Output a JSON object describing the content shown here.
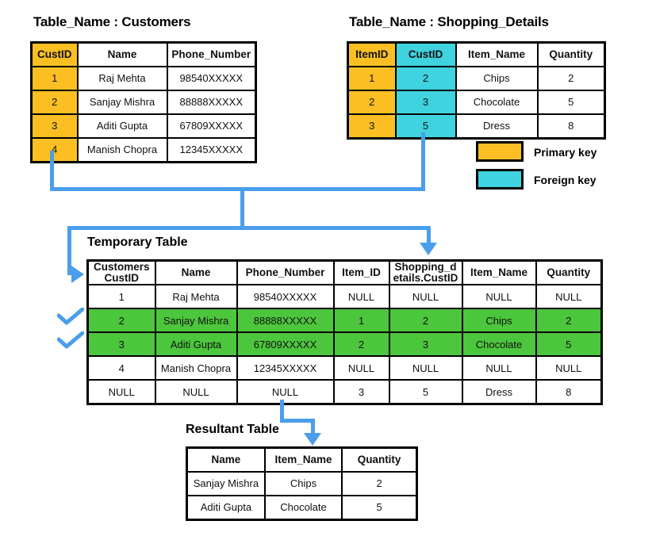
{
  "diagram": {
    "title_prefix": "Table_Name :",
    "customers": {
      "title": "Table_Name : Customers",
      "columns": [
        "CustID",
        "Name",
        "Phone_Number"
      ],
      "rows": [
        [
          "1",
          "Raj Mehta",
          "98540XXXXX"
        ],
        [
          "2",
          "Sanjay Mishra",
          "88888XXXXX"
        ],
        [
          "3",
          "Aditi Gupta",
          "67809XXXXX"
        ],
        [
          "4",
          "Manish Chopra",
          "12345XXXXX"
        ]
      ]
    },
    "shopping_details": {
      "title": "Table_Name : Shopping_Details",
      "columns": [
        "ItemID",
        "CustID",
        "Item_Name",
        "Quantity"
      ],
      "rows": [
        [
          "1",
          "2",
          "Chips",
          "2"
        ],
        [
          "2",
          "3",
          "Chocolate",
          "5"
        ],
        [
          "3",
          "5",
          "Dress",
          "8"
        ]
      ]
    },
    "legend": {
      "primary_key_label": "Primary key",
      "foreign_key_label": "Foreign key",
      "primary_key_color": "#FBBF24",
      "foreign_key_color": "#3FD2DF"
    },
    "temporary_table": {
      "title": "Temporary Table",
      "columns": [
        "Customers CustID",
        "Name",
        "Phone_Number",
        "Item_ID",
        "Shopping_details.CustID",
        "Item_Name",
        "Quantity"
      ],
      "column_lines": [
        [
          "Customers",
          "CustID"
        ],
        [
          "Name"
        ],
        [
          "Phone_Number"
        ],
        [
          "Item_ID"
        ],
        [
          "Shopping_d",
          "etails.CustID"
        ],
        [
          "Item_Name"
        ],
        [
          "Quantity"
        ]
      ],
      "rows": [
        {
          "highlighted": false,
          "cells": [
            "1",
            "Raj Mehta",
            "98540XXXXX",
            "NULL",
            "NULL",
            "NULL",
            "NULL"
          ]
        },
        {
          "highlighted": true,
          "cells": [
            "2",
            "Sanjay Mishra",
            "88888XXXXX",
            "1",
            "2",
            "Chips",
            "2"
          ]
        },
        {
          "highlighted": true,
          "cells": [
            "3",
            "Aditi Gupta",
            "67809XXXXX",
            "2",
            "3",
            "Chocolate",
            "5"
          ]
        },
        {
          "highlighted": false,
          "cells": [
            "4",
            "Manish Chopra",
            "12345XXXXX",
            "NULL",
            "NULL",
            "NULL",
            "NULL"
          ]
        },
        {
          "highlighted": false,
          "cells": [
            "NULL",
            "NULL",
            "NULL",
            "3",
            "5",
            "Dress",
            "8"
          ]
        }
      ],
      "highlight_color": "#4CC63C"
    },
    "resultant_table": {
      "title": "Resultant Table",
      "columns": [
        "Name",
        "Item_Name",
        "Quantity"
      ],
      "rows": [
        [
          "Sanjay Mishra",
          "Chips",
          "2"
        ],
        [
          "Aditi Gupta",
          "Chocolate",
          "5"
        ]
      ]
    },
    "connector_color": "#4A9EEA"
  }
}
